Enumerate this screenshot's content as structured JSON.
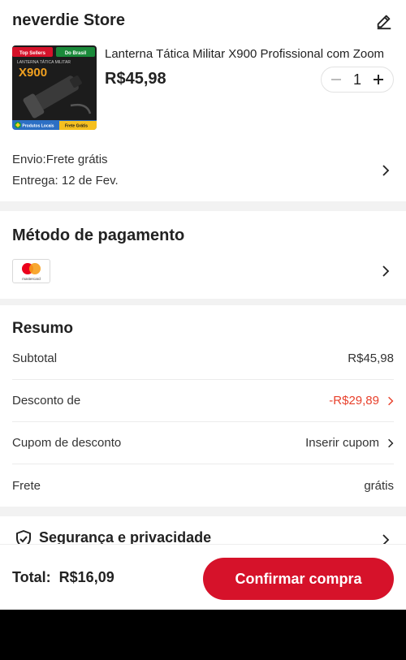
{
  "store": {
    "name": "neverdie Store",
    "product": {
      "title": "Lanterna Tática Militar X900 Profissional com Zoom",
      "price": "R$45,98",
      "quantity": "1",
      "image_text": {
        "badge_left": "Top Sellers",
        "badge_right": "Do Brasil",
        "brand": "X900",
        "caption": "LANTERNA TÁTICA MILITAR",
        "footer_left": "Produtos Locais",
        "footer_right": "Frete Grátis"
      }
    },
    "shipping": "Envio:Frete grátis",
    "delivery": "Entrega: 12 de Fev."
  },
  "payment": {
    "title": "Método de pagamento",
    "card_brand": "mastercard"
  },
  "summary": {
    "title": "Resumo",
    "rows": [
      {
        "label": "Subtotal",
        "value": "R$45,98"
      },
      {
        "label": "Desconto de",
        "value": "-R$29,89"
      },
      {
        "label": "Cupom de desconto",
        "value": "Inserir cupom"
      },
      {
        "label": "Frete",
        "value": "grátis"
      }
    ]
  },
  "security": {
    "title": "Segurança e privacidade"
  },
  "footer": {
    "total": "Total:  R$16,09",
    "confirm_label": "Confirmar compra"
  },
  "colors": {
    "accent": "#d6122a",
    "discount": "#e8412c"
  },
  "icons": [
    "edit-icon",
    "chevron-right-icon",
    "minus-icon",
    "plus-icon",
    "mastercard-icon",
    "shield-check-icon"
  ]
}
